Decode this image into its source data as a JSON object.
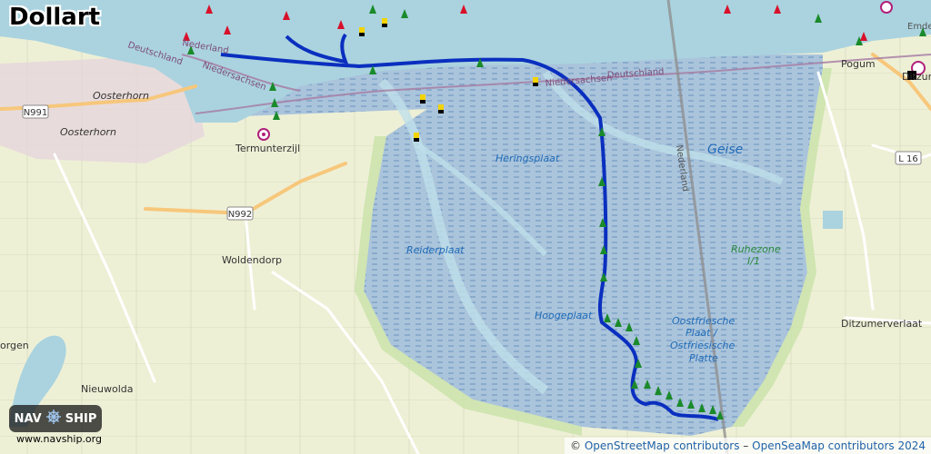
{
  "title": "Dollart",
  "logo": {
    "left": "NAV",
    "right": "SHIP",
    "icon": "ship-wheel-icon",
    "url": "www.navship.org"
  },
  "attribution": {
    "prefix": "© ",
    "osm": "OpenStreetMap contributors",
    "sep": " – ",
    "seamap": "OpenSeaMap contributors 2024"
  },
  "places": {
    "pogum": "Pogum",
    "ditzum": "Ditzum",
    "oosterhorn_1": "Oosterhorn",
    "oosterhorn_2": "Oosterhorn",
    "termunterzijl": "Termunterzijl",
    "woldendorp": "Woldendorp",
    "nieuwolda": "Nieuwolda",
    "borgen": "orgen",
    "ditzumerverlaat": "Ditzumerverlaat",
    "emden": "Emden"
  },
  "roads": {
    "n991": "N991",
    "n992": "N992",
    "l16": "L 16"
  },
  "water_labels": {
    "heringsplaat": "Heringsplaat",
    "geise": "Geise",
    "reiderplaat": "Reiderplaat",
    "hoogeplaat": "Hoogeplaat",
    "ruhezone_1": "Ruhezone",
    "ruhezone_2": "I/1",
    "oostfriesche_1": "Oostfriesche",
    "oostfriesche_2": "Plaat /",
    "oostfriesche_3": "Ostfriesische",
    "oostfriesche_4": "Platte"
  },
  "borders": {
    "deutschland_1": "Deutschland",
    "nederland_1": "Nederland",
    "niedersachsen_1": "Niedersachsen",
    "niedersachsen_2": "Niedersachsen",
    "deutschland_2": "Deutschland",
    "nederland_2": "Nederland"
  },
  "colors": {
    "land": "#f2efe6",
    "farmland": "#eef0d5",
    "water": "#aad3df",
    "mudflat": "#a9c6dc",
    "route": "#0a2fbf",
    "buoy_green": "#1a8a2a",
    "buoy_red": "#d8102a"
  }
}
